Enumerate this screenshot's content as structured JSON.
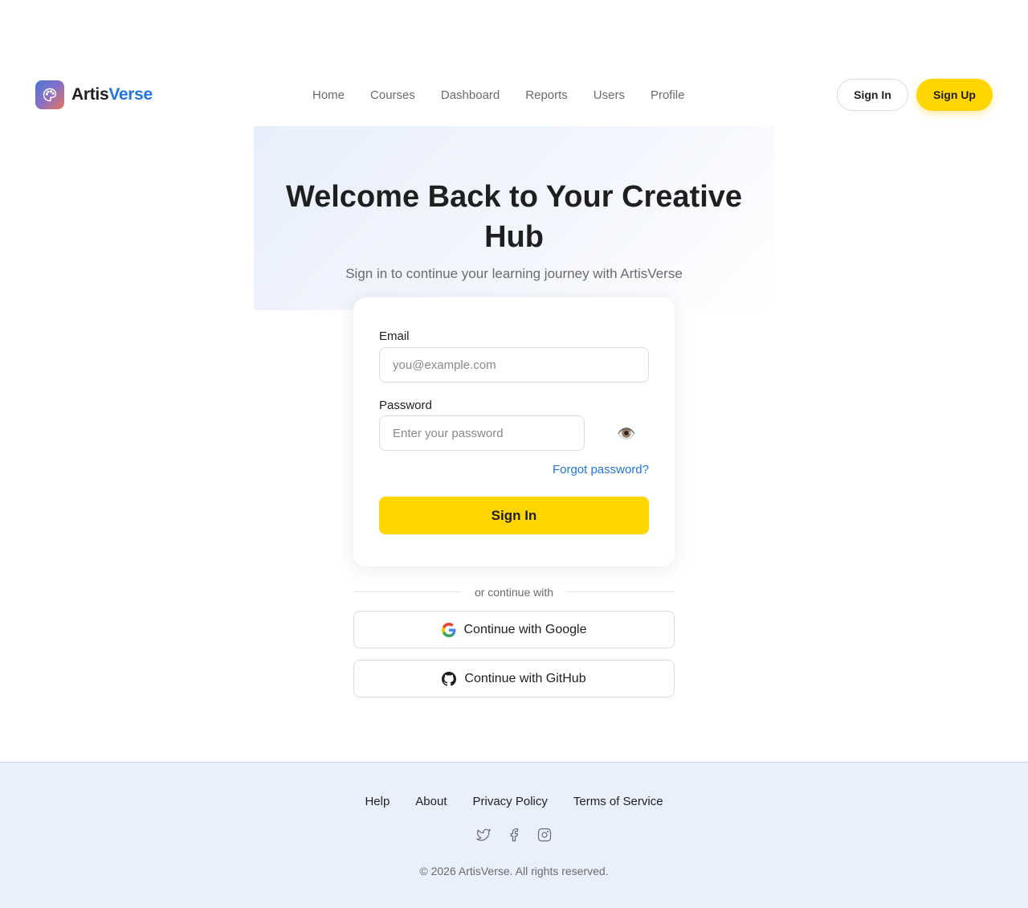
{
  "brand": {
    "name_part1": "Artis",
    "name_part2": "Verse",
    "logo_icon": "palette-icon"
  },
  "nav": {
    "items": [
      {
        "label": "Home"
      },
      {
        "label": "Courses"
      },
      {
        "label": "Dashboard"
      },
      {
        "label": "Reports"
      },
      {
        "label": "Users"
      },
      {
        "label": "Profile"
      }
    ],
    "sign_in_label": "Sign In",
    "sign_up_label": "Sign Up"
  },
  "hero": {
    "title": "Welcome Back to Your Creative Hub",
    "subtitle": "Sign in to continue your learning journey with ArtisVerse"
  },
  "form": {
    "email_label": "Email",
    "email_placeholder": "you@example.com",
    "email_value": "",
    "password_label": "Password",
    "password_placeholder": "Enter your password",
    "password_value": "",
    "toggle_icon": "eye-icon",
    "forgot_label": "Forgot password?",
    "submit_label": "Sign In"
  },
  "divider_text": "or continue with",
  "oauth": {
    "google_label": "Continue with Google",
    "github_label": "Continue with GitHub"
  },
  "footer": {
    "links": [
      {
        "label": "Help"
      },
      {
        "label": "About"
      },
      {
        "label": "Privacy Policy"
      },
      {
        "label": "Terms of Service"
      }
    ],
    "social_icons": [
      "twitter-icon",
      "facebook-icon",
      "instagram-icon"
    ],
    "copyright": "© 2026 ArtisVerse. All rights reserved."
  },
  "colors": {
    "accent": "#ffd600",
    "link": "#2176e0",
    "footer_bg": "#e9f0fc"
  }
}
